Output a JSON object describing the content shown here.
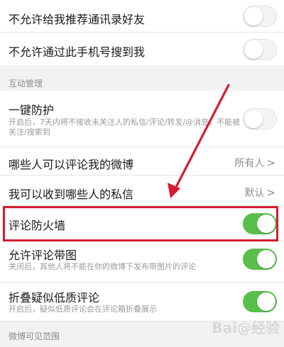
{
  "rows": [
    {
      "title": "不允许给我推荐通讯录好友",
      "toggle": "off"
    },
    {
      "title": "不允许通过此手机号搜到我",
      "toggle": "off"
    }
  ],
  "section_interaction": "互动管理",
  "one_click": {
    "title": "一键防护",
    "desc": "开启后，7天内将不接收未关注人的私信/评论/转发/@消息，不能被关注/搜索到",
    "toggle": "off"
  },
  "who_comment": {
    "title": "哪些人可以评论我的微博",
    "value": "所有人",
    "chevron": ">"
  },
  "who_message": {
    "title": "我可以收到哪些人的私信",
    "value": "默认",
    "chevron": ">"
  },
  "firewall": {
    "title": "评论防火墙",
    "toggle": "on"
  },
  "allow_images": {
    "title": "允许评论带图",
    "desc": "关闭后，其他人将不能在你的微博下发布带图片的评论",
    "toggle": "on"
  },
  "fold_low": {
    "title": "折叠疑似低质评论",
    "desc": "开启后，疑似低质评论会在评论箱折叠展示",
    "toggle": "on"
  },
  "section_visibility": "微博可见范围",
  "watermark": "Bai@经验",
  "colors": {
    "accent_green": "#58bf4b",
    "annotation_red": "#d61c2e"
  }
}
